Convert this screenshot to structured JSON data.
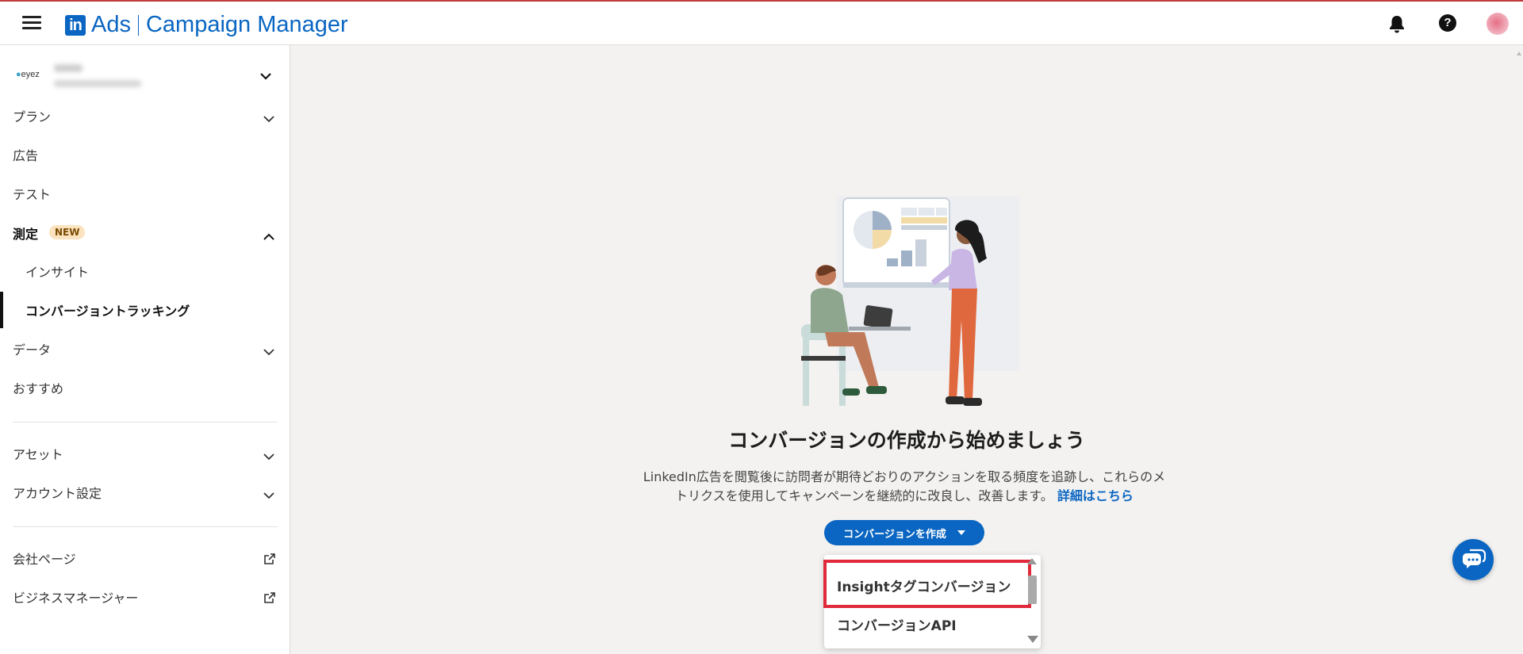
{
  "app": {
    "logo_mark": "in",
    "product_short": "Ads",
    "product_name": "Campaign Manager",
    "brand_color": "#0a66c2"
  },
  "account": {
    "logo_text": "eyez"
  },
  "sidebar": {
    "items": [
      {
        "label": "プラン",
        "expandable": true
      },
      {
        "label": "広告",
        "expandable": false
      },
      {
        "label": "テスト",
        "expandable": false
      },
      {
        "label": "測定",
        "badge": "NEW",
        "expandable": true,
        "expanded": true
      },
      {
        "label": "インサイト",
        "sub": true
      },
      {
        "label": "コンバージョントラッキング",
        "sub": true,
        "active": true
      },
      {
        "label": "データ",
        "expandable": true
      },
      {
        "label": "おすすめ",
        "expandable": false
      },
      {
        "label": "アセット",
        "expandable": true
      },
      {
        "label": "アカウント設定",
        "expandable": true
      },
      {
        "label": "会社ページ",
        "external": true
      },
      {
        "label": "ビジネスマネージャー",
        "external": true
      }
    ]
  },
  "main": {
    "headline": "コンバージョンの作成から始めましょう",
    "description": "LinkedIn広告を閲覧後に訪問者が期待どおりのアクションを取る頻度を追跡し、これらのメトリクスを使用してキャンペーンを継続的に改良し、改善します。",
    "learn_more": "詳細はこちら",
    "create_button": "コンバージョンを作成",
    "dropdown_options": [
      "Insightタグコンバージョン",
      "コンバージョンAPI"
    ],
    "highlight_color": "#e0293a"
  },
  "icons": {
    "menu": "hamburger-icon",
    "notifications": "bell-icon",
    "help": "help-icon",
    "messaging": "chat-icon",
    "external_link": "external-link-icon"
  }
}
